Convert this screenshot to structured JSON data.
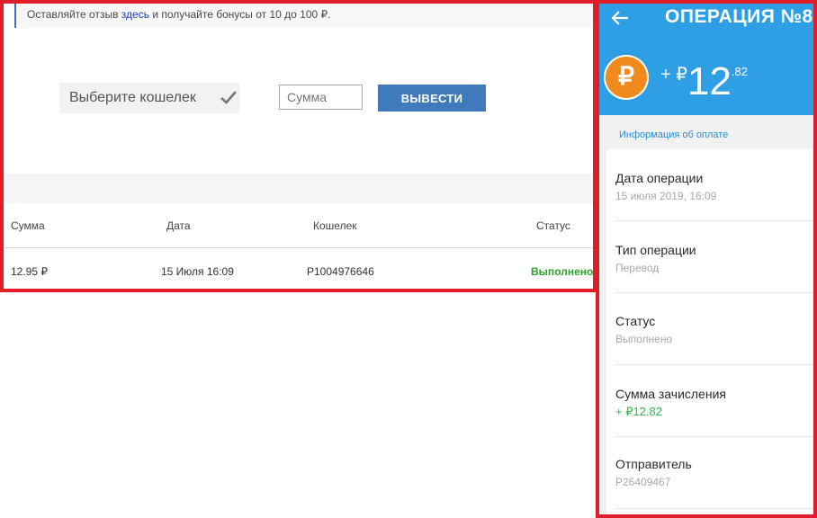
{
  "left": {
    "notice": {
      "prefix": "Оставляйте отзыв",
      "link": "здесь",
      "suffix": "и получайте бонусы от 10 до 100 ₽."
    },
    "wallet_select": {
      "label": "Выберите кошелек"
    },
    "amount_input": {
      "placeholder": "Сумма",
      "value": ""
    },
    "withdraw_button": "ВЫВЕСТИ",
    "table": {
      "headers": [
        "Сумма",
        "Дата",
        "Кошелек",
        "Статус"
      ],
      "rows": [
        [
          "12.95 ₽",
          "15 Июля 16:09",
          "P1004976646",
          "Выполнено"
        ]
      ]
    }
  },
  "right": {
    "title": "ОПЕРАЦИЯ №8",
    "coin_symbol": "₽",
    "amount": {
      "sign": "+ ₽",
      "main": "12",
      "cents": ".82"
    },
    "tab": "Информация об оплате",
    "details": [
      {
        "label": "Дата операции",
        "value": "15 июля 2019, 16:09"
      },
      {
        "label": "Тип операции",
        "value": "Перевод"
      },
      {
        "label": "Статус",
        "value": "Выполнено"
      },
      {
        "label": "Сумма зачисления",
        "value": "+ ₽12.82"
      },
      {
        "label": "Отправитель",
        "value": "P26409467"
      }
    ]
  },
  "colors": {
    "frame": "#e11d2a",
    "header_blue": "#2f9fe5",
    "button_blue": "#3f7bbb",
    "success_green": "#2aa52a",
    "coin_orange": "#f08a1c"
  },
  "icons": [
    "checkmark-icon",
    "back-arrow-icon",
    "ruble-coin-icon"
  ]
}
